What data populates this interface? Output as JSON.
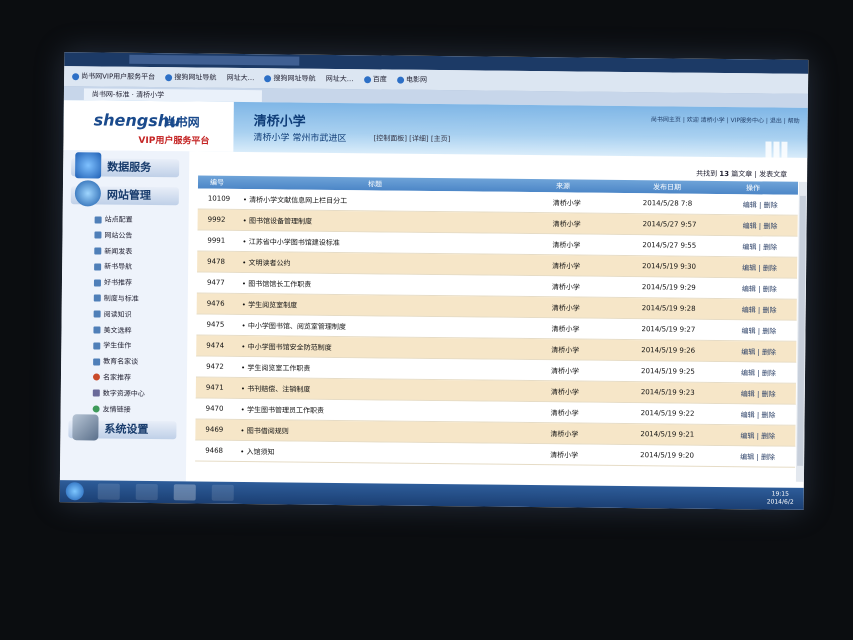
{
  "browser": {
    "favorites": [
      "尚书网VIP用户服务平台",
      "搜狗网址导航",
      "网址大...",
      "搜狗网址导航",
      "网址大...",
      "百度",
      "电影网"
    ],
    "tab_title": "尚书网-标准 · 清桥小学"
  },
  "header": {
    "logo_en": "shengshu",
    "logo_cn": "尚书网",
    "platform": "VIP用户服务平台",
    "site_name": "清桥小学",
    "site_sub": "清桥小学  常州市武进区",
    "site_links": "[控制面板] [详细] [主页]",
    "welcome": "尚书网主页 | 欢迎 清桥小学 | VIP服务中心 | 退出 | 帮助"
  },
  "sidebar": {
    "sections": [
      "数据服务",
      "网站管理",
      "系统设置"
    ],
    "items": [
      "站点配置",
      "网站公告",
      "新闻发表",
      "新书导航",
      "好书推荐",
      "制度与标准",
      "阅读知识",
      "美文选粹",
      "学生佳作",
      "教育名家谈",
      "名家推荐",
      "数字资源中心",
      "友情链接"
    ]
  },
  "stats": {
    "prefix": "共找到",
    "count": "13",
    "suffix": "篇文章",
    "action": "| 发表文章"
  },
  "table": {
    "headers": [
      "编号",
      "标题",
      "来源",
      "发布日期",
      "操作"
    ],
    "rows": [
      {
        "id": "10109",
        "title": "• 清桥小学文献信息网上栏目分工",
        "source": "清桥小学",
        "date": "2014/5/28 7:8",
        "action": "编辑 | 删除"
      },
      {
        "id": "9992",
        "title": "• 图书馆设备管理制度",
        "source": "清桥小学",
        "date": "2014/5/27 9:57",
        "action": "编辑 | 删除"
      },
      {
        "id": "9991",
        "title": "• 江苏省中小学图书馆建设标准",
        "source": "清桥小学",
        "date": "2014/5/27 9:55",
        "action": "编辑 | 删除"
      },
      {
        "id": "9478",
        "title": "• 文明读者公约",
        "source": "清桥小学",
        "date": "2014/5/19 9:30",
        "action": "编辑 | 删除"
      },
      {
        "id": "9477",
        "title": "• 图书馆馆长工作职责",
        "source": "清桥小学",
        "date": "2014/5/19 9:29",
        "action": "编辑 | 删除"
      },
      {
        "id": "9476",
        "title": "• 学生阅览室制度",
        "source": "清桥小学",
        "date": "2014/5/19 9:28",
        "action": "编辑 | 删除"
      },
      {
        "id": "9475",
        "title": "• 中小学图书馆、阅览室管理制度",
        "source": "清桥小学",
        "date": "2014/5/19 9:27",
        "action": "编辑 | 删除"
      },
      {
        "id": "9474",
        "title": "• 中小学图书馆安全防范制度",
        "source": "清桥小学",
        "date": "2014/5/19 9:26",
        "action": "编辑 | 删除"
      },
      {
        "id": "9472",
        "title": "• 学生阅览室工作职责",
        "source": "清桥小学",
        "date": "2014/5/19 9:25",
        "action": "编辑 | 删除"
      },
      {
        "id": "9471",
        "title": "• 书刊赔偿、注销制度",
        "source": "清桥小学",
        "date": "2014/5/19 9:23",
        "action": "编辑 | 删除"
      },
      {
        "id": "9470",
        "title": "• 学生图书管理员工作职责",
        "source": "清桥小学",
        "date": "2014/5/19 9:22",
        "action": "编辑 | 删除"
      },
      {
        "id": "9469",
        "title": "• 图书借阅规则",
        "source": "清桥小学",
        "date": "2014/5/19 9:21",
        "action": "编辑 | 删除"
      },
      {
        "id": "9468",
        "title": "• 入馆须知",
        "source": "清桥小学",
        "date": "2014/5/19 9:20",
        "action": "编辑 | 删除"
      }
    ]
  },
  "taskbar": {
    "time": "19:15",
    "date": "2014/6/2"
  }
}
